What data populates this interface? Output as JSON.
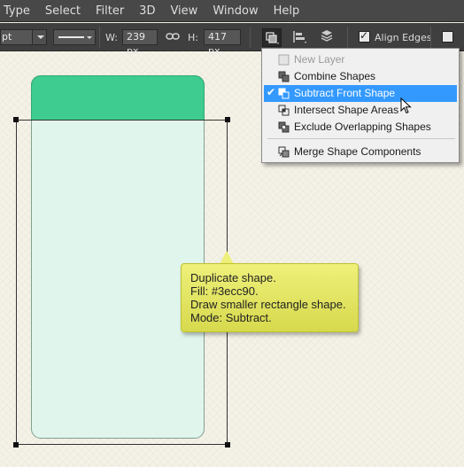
{
  "menubar": {
    "items": [
      "Type",
      "Select",
      "Filter",
      "3D",
      "View",
      "Window",
      "Help"
    ]
  },
  "options": {
    "stroke_size_value": "pt",
    "width_label": "W:",
    "width_value": "239 px",
    "height_label": "H:",
    "height_value": "417 px",
    "align_edges_label": "Align Edges",
    "align_edges_checked": true
  },
  "path_ops_menu": {
    "items": [
      {
        "label": "New Layer",
        "disabled": true,
        "icon": "new-layer-icon"
      },
      {
        "label": "Combine Shapes",
        "icon": "combine-shapes-icon"
      },
      {
        "label": "Subtract Front Shape",
        "selected": true,
        "icon": "subtract-front-shape-icon"
      },
      {
        "label": "Intersect Shape Areas",
        "icon": "intersect-shape-areas-icon"
      },
      {
        "label": "Exclude Overlapping Shapes",
        "icon": "exclude-overlapping-shapes-icon"
      },
      {
        "label": "Merge Shape Components",
        "icon": "merge-shape-components-icon"
      }
    ]
  },
  "tooltip": {
    "lines": [
      "Duplicate shape.",
      "Fill: #3ecc90.",
      "Draw smaller rectangle shape.",
      "Mode: Subtract."
    ]
  },
  "colors": {
    "shape_top_fill": "#3ecc90",
    "shape_body_fill": "#e0f5ec",
    "menu_highlight": "#3399ff",
    "tooltip_fill": "#e8ea6a"
  }
}
